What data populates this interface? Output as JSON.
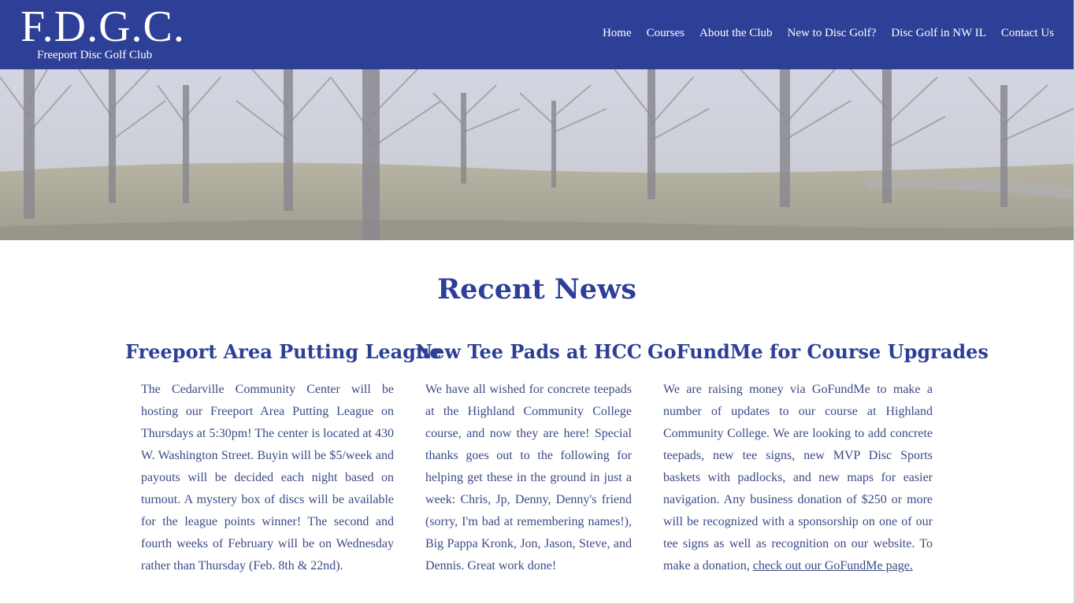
{
  "site": {
    "logo_main": "F.D.G.C.",
    "logo_sub": "Freeport Disc Golf Club"
  },
  "nav": {
    "items": [
      {
        "label": "Home"
      },
      {
        "label": "Courses"
      },
      {
        "label": "About the Club"
      },
      {
        "label": "New to Disc Golf?"
      },
      {
        "label": "Disc Golf in NW IL"
      },
      {
        "label": "Contact Us"
      }
    ]
  },
  "hero": {
    "image": "park-trees-photo"
  },
  "news": {
    "title": "Recent News",
    "articles": [
      {
        "title": "Freeport Area Putting League",
        "body": "The Cedarville Community Center will be hosting our Freeport Area Putting League on Thursdays at 5:30pm! The center is located at 430 W. Washington Street. Buyin will be $5/week and payouts will be decided each night based on turnout. A mystery box of discs will be available for the league points winner! The second and fourth weeks of February will be on Wednesday rather than Thursday (Feb. 8th & 22nd)."
      },
      {
        "title": "New Tee Pads at HCC",
        "body": "We have all wished for concrete teepads at the Highland Community College course, and now they are here! Special thanks goes out to the following for helping get these in the ground in just a week: Chris, Jp, Denny, Denny's friend (sorry, I'm bad at remembering names!), Big Pappa Kronk, Jon, Jason, Steve, and Dennis. Great work done!"
      },
      {
        "title": "GoFundMe for Course Upgrades",
        "body": "We are raising money via GoFundMe to make a number of updates to our course at Highland Community College. We are looking to add concrete teepads, new tee signs, new MVP Disc Sports baskets with padlocks, and new maps for easier navigation. Any business donation of $250 or more will be recognized with a sponsorship on one of our tee signs as well as recognition on our website. To make a donation, ",
        "link": "check out our GoFundMe page."
      }
    ]
  },
  "colors": {
    "header_bg": "#2d3f96",
    "heading": "#2d3f96",
    "body_text": "#3b4a86"
  }
}
